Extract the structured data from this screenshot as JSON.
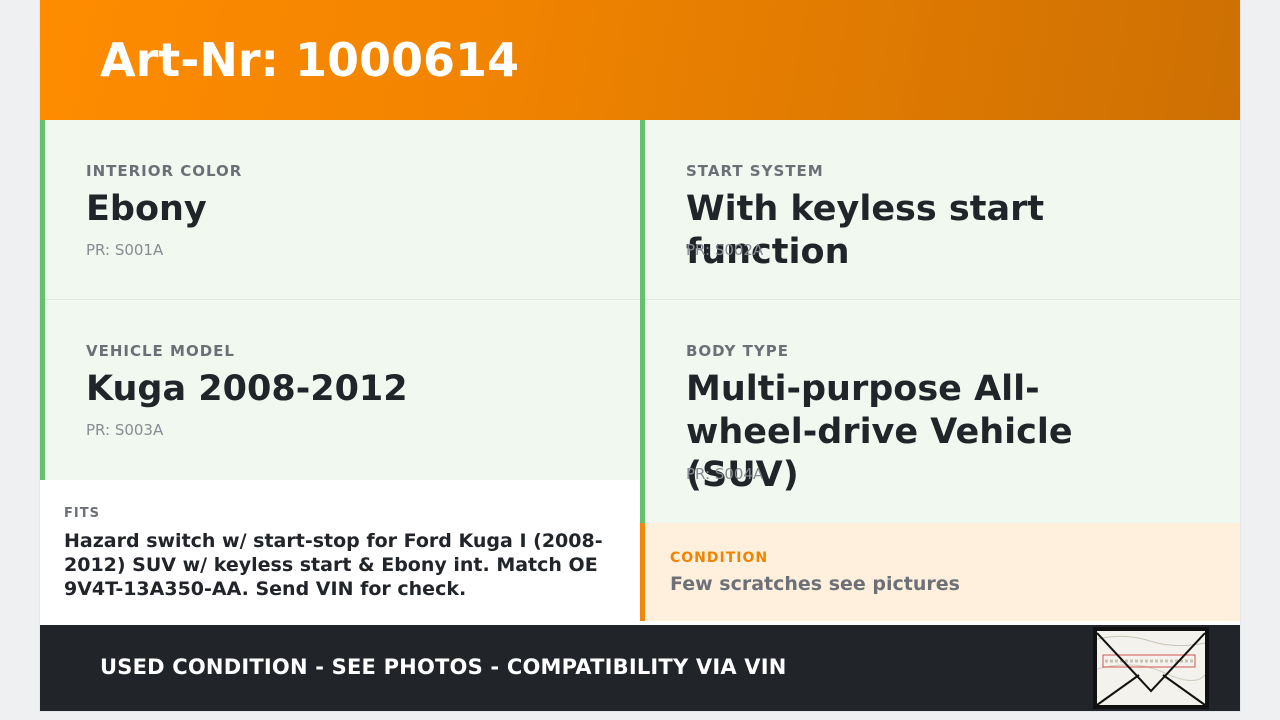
{
  "header": {
    "title": "Art-Nr: 1000614"
  },
  "cards": [
    {
      "label": "INTERIOR COLOR",
      "value": "Ebony",
      "pr": "PR: S001A"
    },
    {
      "label": "START SYSTEM",
      "value": "With keyless start function",
      "pr": "PR: S002A"
    },
    {
      "label": "VEHICLE MODEL",
      "value": "Kuga 2008-2012",
      "pr": "PR: S003A"
    },
    {
      "label": "BODY TYPE",
      "value": "Multi-purpose All-wheel-drive Vehicle (SUV)",
      "pr": "PR: S004A"
    }
  ],
  "fits": {
    "label": "FITS",
    "text": "Hazard switch w/ start-stop for Ford Kuga I (2008-2012) SUV w/ keyless start & Ebony int. Match OE 9V4T-13A350-AA. Send VIN for check."
  },
  "condition": {
    "label": "CONDITION",
    "text": "Few scratches see pictures"
  },
  "footer": {
    "text": "USED CONDITION - SEE PHOTOS - COMPATIBILITY VIA VIN"
  },
  "colors": {
    "header_orange": "#ff8c00",
    "card_accent_green": "#66c06e",
    "card_background": "#f0f8f0",
    "condition_accent": "#f0880f",
    "condition_background": "#fff0dd",
    "footer_background": "#212529"
  }
}
